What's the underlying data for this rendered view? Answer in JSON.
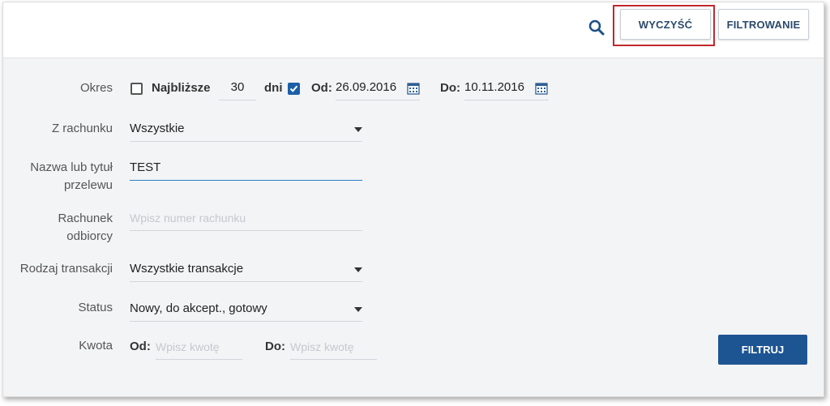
{
  "toolbar": {
    "search_icon": "search-icon",
    "clear_label": "WYCZYŚĆ",
    "filter_toggle_label": "FILTROWANIE",
    "highlight_color": "#c0282e"
  },
  "form": {
    "period": {
      "label": "Okres",
      "nearest_label": "Najbliższe",
      "nearest_checked": false,
      "days_value": "30",
      "days_unit": "dni",
      "range_checked": true,
      "from_label": "Od:",
      "from_value": "26.09.2016",
      "to_label": "Do:",
      "to_value": "10.11.2016"
    },
    "account": {
      "label": "Z rachunku",
      "value": "Wszystkie"
    },
    "title": {
      "label_line1": "Nazwa lub tytuł",
      "label_line2": "przelewu",
      "value": "TEST"
    },
    "recipient": {
      "label_line1": "Rachunek",
      "label_line2": "odbiorcy",
      "placeholder": "Wpisz numer rachunku"
    },
    "type": {
      "label": "Rodzaj transakcji",
      "value": "Wszystkie transakcje"
    },
    "status": {
      "label": "Status",
      "value": "Nowy, do akcept., gotowy"
    },
    "amount": {
      "label": "Kwota",
      "from_label": "Od:",
      "from_placeholder": "Wpisz kwotę",
      "to_label": "Do:",
      "to_placeholder": "Wpisz kwotę"
    }
  },
  "actions": {
    "filter_label": "FILTRUJ",
    "primary_color": "#1d5592"
  }
}
